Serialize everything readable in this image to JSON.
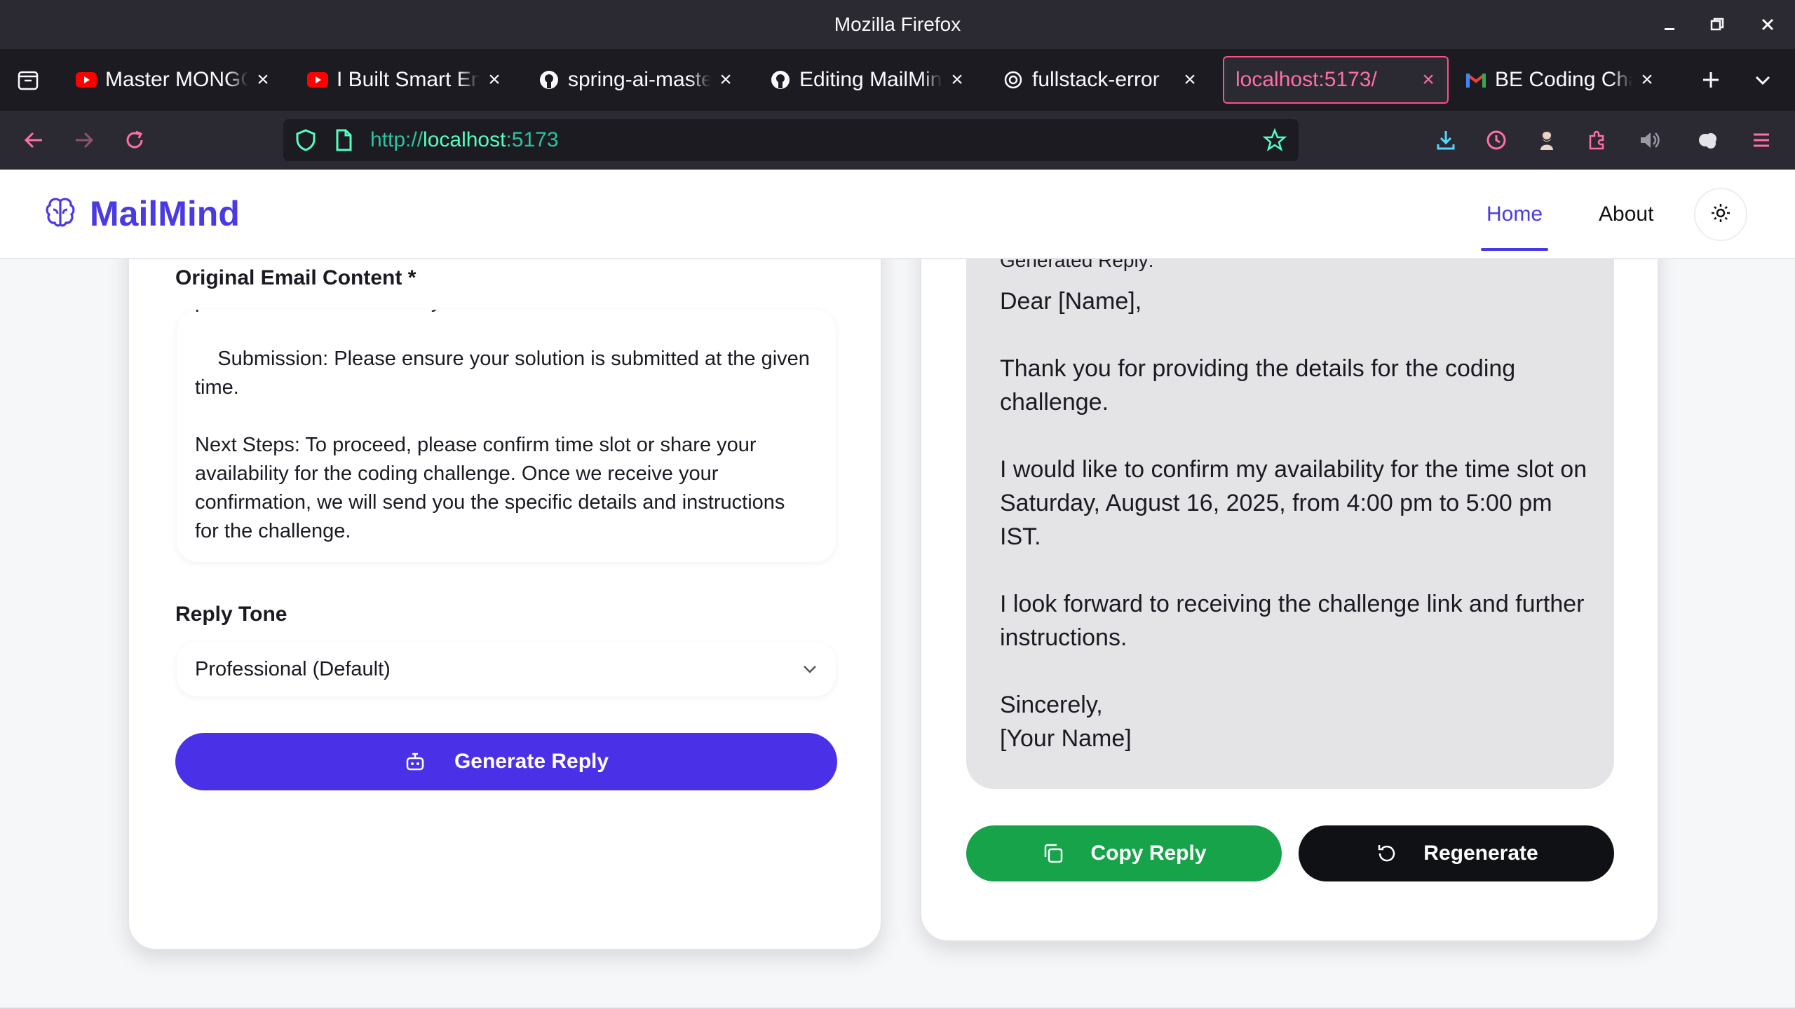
{
  "browser": {
    "window_title": "Mozilla Firefox",
    "tabs": [
      {
        "label": "Master MONGO",
        "favicon": "youtube-icon"
      },
      {
        "label": "I Built Smart Em",
        "favicon": "youtube-icon"
      },
      {
        "label": "spring-ai-maste",
        "favicon": "github-icon"
      },
      {
        "label": "Editing MailMin",
        "favicon": "github-icon"
      },
      {
        "label": "fullstack-error",
        "favicon": "openai-icon"
      },
      {
        "label": "localhost:5173/",
        "favicon": "none",
        "active": true
      },
      {
        "label": "BE Coding Chal",
        "favicon": "gmail-icon"
      }
    ],
    "url_scheme": "http://",
    "url_host": "localhost",
    "url_port": ":5173"
  },
  "app": {
    "brand": "MailMind",
    "nav": {
      "home": "Home",
      "about": "About"
    },
    "form": {
      "email_label": "Original Email Content *",
      "email_content": "provided once we receive your confirmed time slot.\n\n    Submission: Please ensure your solution is submitted at the given time.\n\nNext Steps: To proceed, please confirm time slot or share your availability for the coding challenge. Once we receive your confirmation, we will send you the specific details and instructions for the challenge.",
      "tone_label": "Reply Tone",
      "tone_value": "Professional (Default)",
      "generate_button": "Generate Reply"
    },
    "reply": {
      "label": "Generated Reply:",
      "text": "Dear [Name],\n\nThank you for providing the details for the coding challenge.\n\nI would like to confirm my availability for the time slot on Saturday, August 16, 2025, from 4:00 pm to 5:00 pm IST.\n\nI look forward to receiving the challenge link and further instructions.\n\nSincerely,\n[Your Name]",
      "copy_button": "Copy Reply",
      "regenerate_button": "Regenerate"
    }
  },
  "colors": {
    "accent": "#4a3ae6",
    "primary_button": "#4a31e8",
    "copy_button": "#16a34a",
    "regenerate_button": "#0f1115",
    "active_tab": "#ff4f8b"
  }
}
